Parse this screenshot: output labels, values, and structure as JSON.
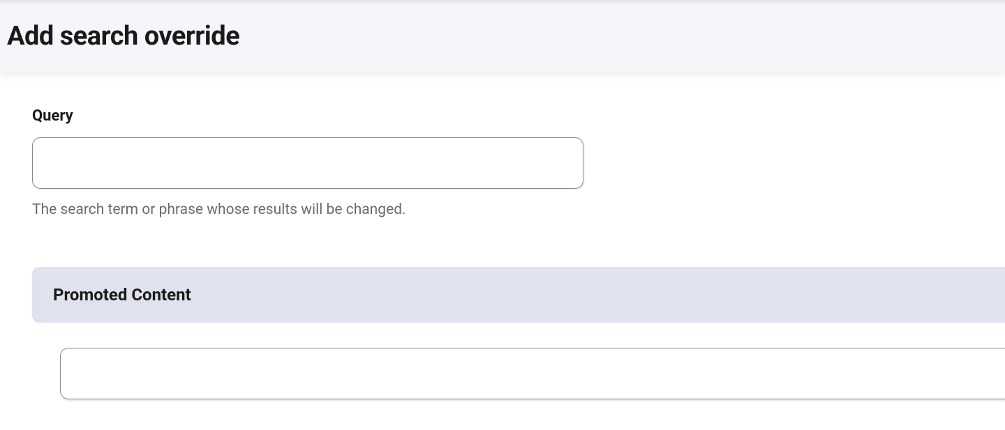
{
  "header": {
    "title": "Add search override"
  },
  "form": {
    "query": {
      "label": "Query",
      "value": "",
      "help_text": "The search term or phrase whose results will be changed."
    },
    "promoted_content": {
      "section_title": "Promoted Content",
      "value": ""
    }
  }
}
